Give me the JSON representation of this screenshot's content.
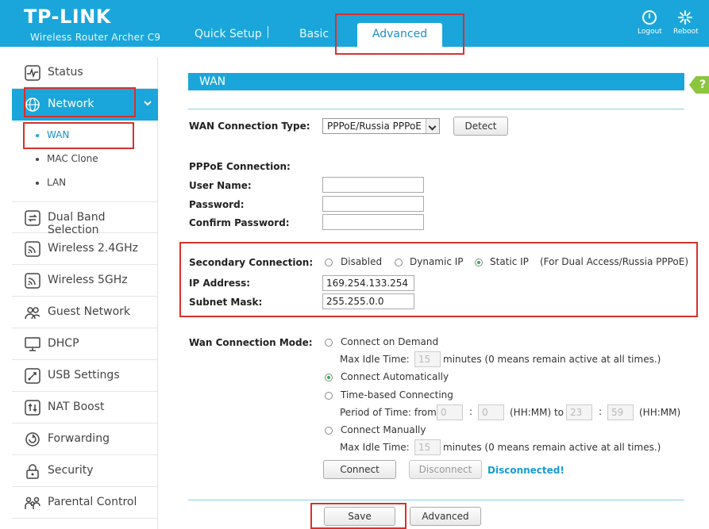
{
  "header": {
    "logo": "TP-LINK",
    "model": "Wireless Router Archer C9",
    "tabs": [
      "Quick Setup",
      "Basic",
      "Advanced"
    ],
    "logout_label": "Logout",
    "reboot_label": "Reboot"
  },
  "sidebar": {
    "items": [
      {
        "label": "Status",
        "icon": "pulse-icon"
      },
      {
        "label": "Network",
        "icon": "globe-icon"
      },
      {
        "label": "Dual Band Selection",
        "icon": "dual-band-icon"
      },
      {
        "label": "Wireless 2.4GHz",
        "icon": "wireless-icon"
      },
      {
        "label": "Wireless 5GHz",
        "icon": "wireless-icon"
      },
      {
        "label": "Guest Network",
        "icon": "guest-icon"
      },
      {
        "label": "DHCP",
        "icon": "monitor-icon"
      },
      {
        "label": "USB Settings",
        "icon": "usb-icon"
      },
      {
        "label": "NAT Boost",
        "icon": "nat-boost-icon"
      },
      {
        "label": "Forwarding",
        "icon": "forwarding-icon"
      },
      {
        "label": "Security",
        "icon": "lock-icon"
      },
      {
        "label": "Parental Control",
        "icon": "family-icon"
      }
    ],
    "network_sub": [
      "WAN",
      "MAC Clone",
      "LAN"
    ]
  },
  "main": {
    "section_title": "WAN",
    "help": "?",
    "wan_type_label": "WAN Connection Type:",
    "wan_type_value": "PPPoE/Russia PPPoE",
    "detect_label": "Detect",
    "pppoe_heading": "PPPoE Connection:",
    "username_label": "User Name:",
    "password_label": "Password:",
    "confirm_label": "Confirm Password:",
    "username_value": "",
    "password_value": "",
    "confirm_value": "",
    "secondary_label": "Secondary Connection:",
    "secondary_options": [
      "Disabled",
      "Dynamic IP",
      "Static IP"
    ],
    "secondary_selected": "Static IP",
    "secondary_note": "(For Dual Access/Russia PPPoE)",
    "ip_label": "IP Address:",
    "ip_value": "169.254.133.254",
    "mask_label": "Subnet Mask:",
    "mask_value": "255.255.0.0",
    "mode_label": "Wan Connection Mode:",
    "mode_options": [
      "Connect on Demand",
      "Connect Automatically",
      "Time-based Connecting",
      "Connect Manually"
    ],
    "mode_selected": "Connect Automatically",
    "max_idle_label": "Max Idle Time:",
    "idle_value_1": "15",
    "idle_value_2": "15",
    "idle_suffix": "minutes (0 means remain active at all times.)",
    "period_label": "Period of Time: from",
    "time_from_h": "0",
    "time_from_m": "0",
    "time_to_h": "23",
    "time_to_m": "59",
    "colon": ":",
    "hhmm_to": "(HH:MM) to",
    "hhmm": "(HH:MM)",
    "connect_label": "Connect",
    "disconnect_label": "Disconnect",
    "status_text": "Disconnected!",
    "save_label": "Save",
    "advanced_label": "Advanced"
  },
  "colors": {
    "accent": "#1aa6db",
    "highlight": "#d9302c",
    "status": "#1a9bd0",
    "radio_on": "#2db04b"
  }
}
